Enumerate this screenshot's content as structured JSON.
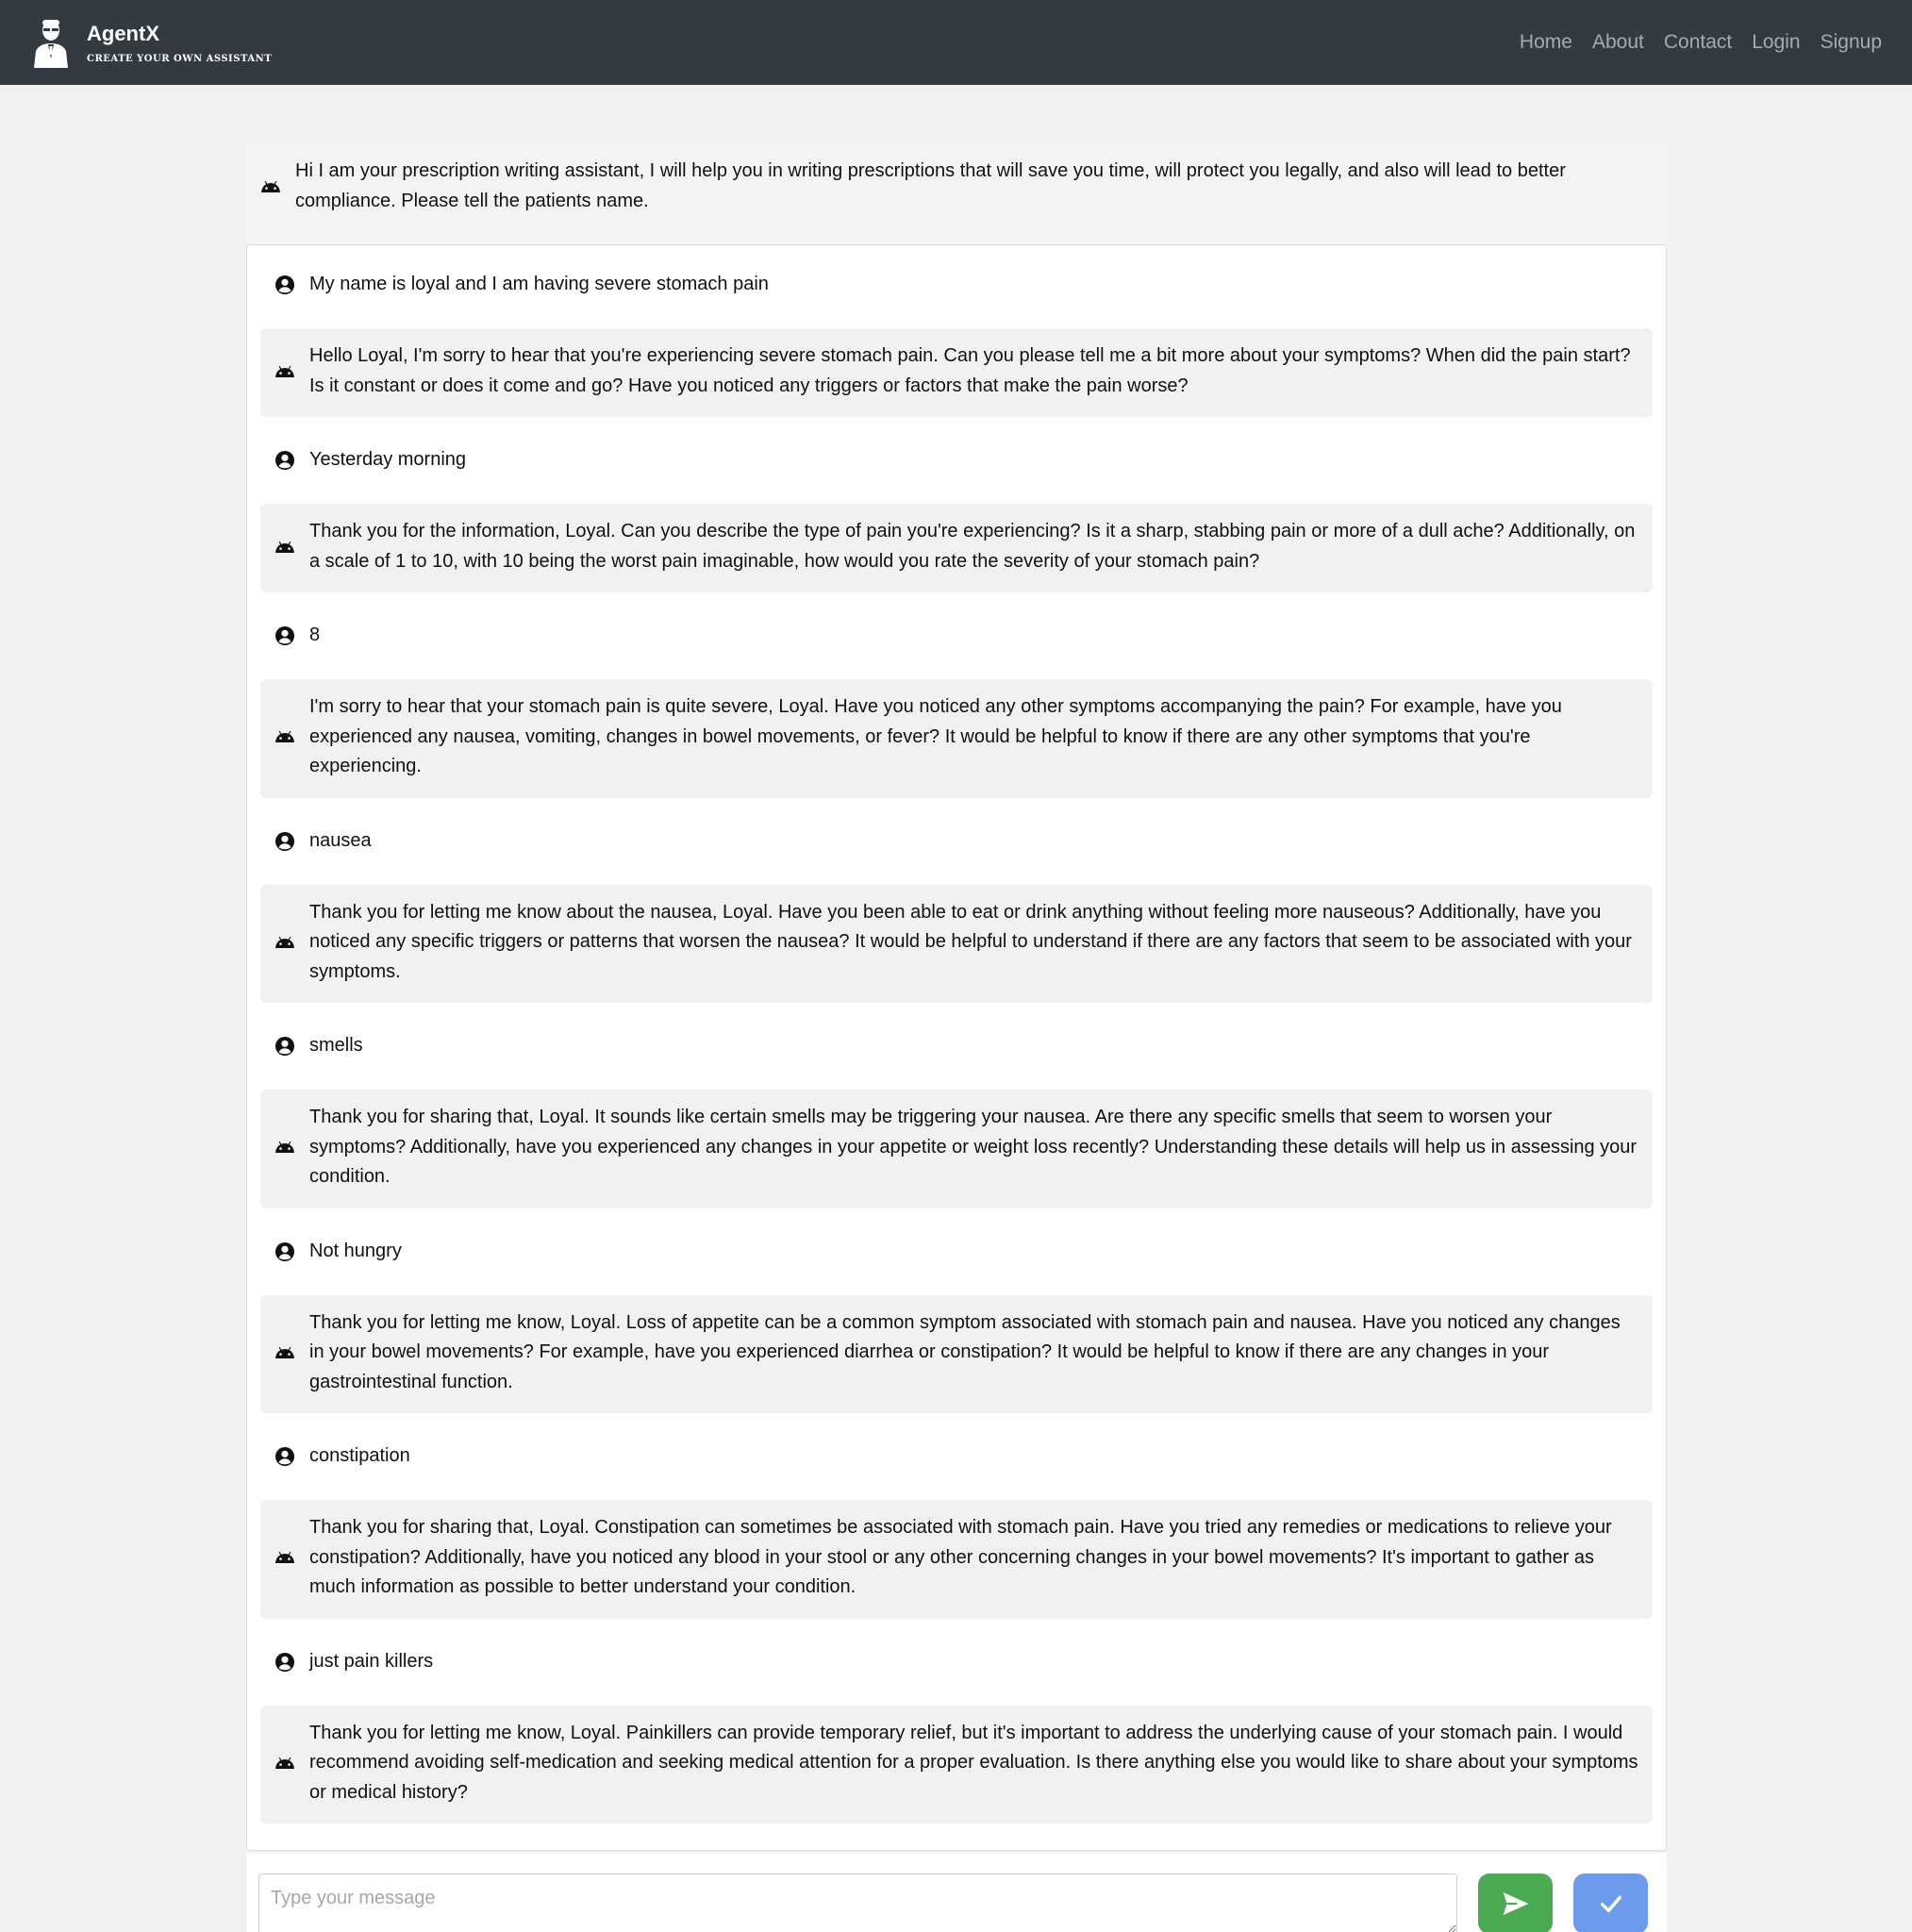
{
  "navbar": {
    "brand_name": "AgentX",
    "brand_tagline": "CREATE YOUR OWN ASSISTANT",
    "links": [
      "Home",
      "About",
      "Contact",
      "Login",
      "Signup"
    ]
  },
  "intro": {
    "icon": "android-icon",
    "text": "Hi I am your prescription writing assistant, I will help you in writing prescriptions that will save you time, will protect you legally, and also will lead to better compliance. Please tell the patients name."
  },
  "messages": [
    {
      "role": "user",
      "icon": "user-circle-icon",
      "text": "My name is loyal and I am having severe stomach pain"
    },
    {
      "role": "bot",
      "icon": "android-icon",
      "text": "Hello Loyal, I'm sorry to hear that you're experiencing severe stomach pain. Can you please tell me a bit more about your symptoms? When did the pain start? Is it constant or does it come and go? Have you noticed any triggers or factors that make the pain worse?"
    },
    {
      "role": "user",
      "icon": "user-circle-icon",
      "text": "Yesterday morning"
    },
    {
      "role": "bot",
      "icon": "android-icon",
      "text": "Thank you for the information, Loyal. Can you describe the type of pain you're experiencing? Is it a sharp, stabbing pain or more of a dull ache? Additionally, on a scale of 1 to 10, with 10 being the worst pain imaginable, how would you rate the severity of your stomach pain?"
    },
    {
      "role": "user",
      "icon": "user-circle-icon",
      "text": "8"
    },
    {
      "role": "bot",
      "icon": "android-icon",
      "text": "I'm sorry to hear that your stomach pain is quite severe, Loyal. Have you noticed any other symptoms accompanying the pain? For example, have you experienced any nausea, vomiting, changes in bowel movements, or fever? It would be helpful to know if there are any other symptoms that you're experiencing."
    },
    {
      "role": "user",
      "icon": "user-circle-icon",
      "text": "nausea"
    },
    {
      "role": "bot",
      "icon": "android-icon",
      "text": "Thank you for letting me know about the nausea, Loyal. Have you been able to eat or drink anything without feeling more nauseous? Additionally, have you noticed any specific triggers or patterns that worsen the nausea? It would be helpful to understand if there are any factors that seem to be associated with your symptoms."
    },
    {
      "role": "user",
      "icon": "user-circle-icon",
      "text": "smells"
    },
    {
      "role": "bot",
      "icon": "android-icon",
      "text": "Thank you for sharing that, Loyal. It sounds like certain smells may be triggering your nausea. Are there any specific smells that seem to worsen your symptoms? Additionally, have you experienced any changes in your appetite or weight loss recently? Understanding these details will help us in assessing your condition."
    },
    {
      "role": "user",
      "icon": "user-circle-icon",
      "text": "Not hungry"
    },
    {
      "role": "bot",
      "icon": "android-icon",
      "text": "Thank you for letting me know, Loyal. Loss of appetite can be a common symptom associated with stomach pain and nausea. Have you noticed any changes in your bowel movements? For example, have you experienced diarrhea or constipation? It would be helpful to know if there are any changes in your gastrointestinal function."
    },
    {
      "role": "user",
      "icon": "user-circle-icon",
      "text": "constipation"
    },
    {
      "role": "bot",
      "icon": "android-icon",
      "text": "Thank you for sharing that, Loyal. Constipation can sometimes be associated with stomach pain. Have you tried any remedies or medications to relieve your constipation? Additionally, have you noticed any blood in your stool or any other concerning changes in your bowel movements? It's important to gather as much information as possible to better understand your condition."
    },
    {
      "role": "user",
      "icon": "user-circle-icon",
      "text": "just pain killers"
    },
    {
      "role": "bot",
      "icon": "android-icon",
      "text": "Thank you for letting me know, Loyal. Painkillers can provide temporary relief, but it's important to address the underlying cause of your stomach pain. I would recommend avoiding self-medication and seeking medical attention for a proper evaluation. Is there anything else you would like to share about your symptoms or medical history?"
    }
  ],
  "composer": {
    "placeholder": "Type your message",
    "value": "",
    "send_icon": "send-icon",
    "confirm_icon": "check-icon"
  },
  "colors": {
    "navbar_bg": "#343a40",
    "send_button": "#4aab52",
    "confirm_button": "#6b9bea",
    "bot_bubble": "#f1f1f1"
  }
}
